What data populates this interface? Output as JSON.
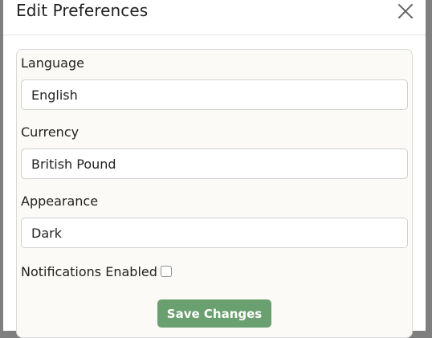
{
  "modal": {
    "title": "Edit Preferences",
    "close_icon": "close-icon"
  },
  "form": {
    "language": {
      "label": "Language",
      "value": "English"
    },
    "currency": {
      "label": "Currency",
      "value": "British Pound"
    },
    "appearance": {
      "label": "Appearance",
      "value": "Dark"
    },
    "notifications": {
      "label": "Notifications Enabled",
      "checked": false
    },
    "save_label": "Save Changes"
  },
  "colors": {
    "accent": "#6a9f6f",
    "card_background": "#fbfaf6",
    "overlay": "#7f7f7f"
  }
}
